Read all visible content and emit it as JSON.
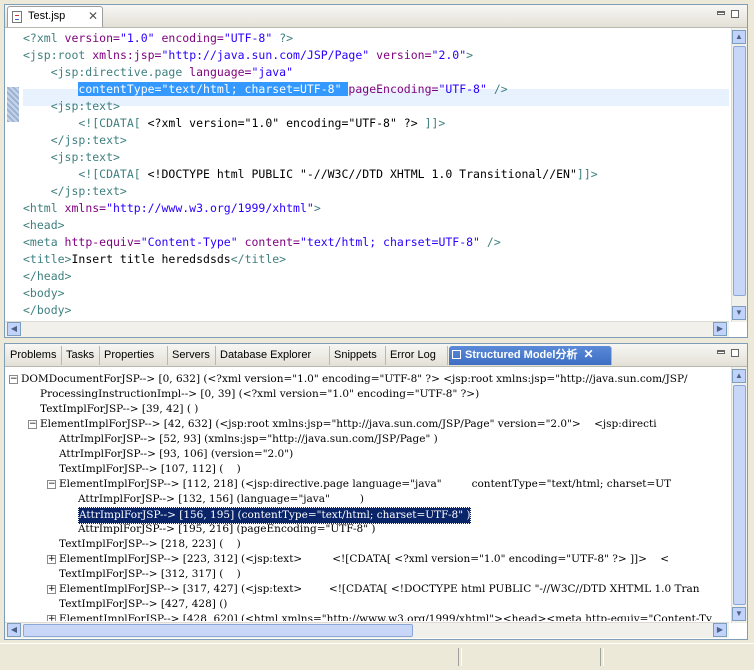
{
  "editor": {
    "tab_label": "Test.jsp",
    "lines": [
      [
        {
          "t": "<?xml ",
          "c": "kw"
        },
        {
          "t": "version=",
          "c": "an"
        },
        {
          "t": "\"1.0\"",
          "c": "av"
        },
        {
          "t": " encoding=",
          "c": "an"
        },
        {
          "t": "\"UTF-8\"",
          "c": "av"
        },
        {
          "t": " ?>",
          "c": "kw"
        }
      ],
      [
        {
          "t": "<jsp:root ",
          "c": "kw"
        },
        {
          "t": "xmlns:jsp=",
          "c": "an"
        },
        {
          "t": "\"http://java.sun.com/JSP/Page\"",
          "c": "av"
        },
        {
          "t": " version=",
          "c": "an"
        },
        {
          "t": "\"2.0\"",
          "c": "av"
        },
        {
          "t": ">",
          "c": "kw"
        }
      ],
      [
        {
          "t": "    <jsp:directive.page ",
          "c": "kw"
        },
        {
          "t": "language=",
          "c": "an"
        },
        {
          "t": "\"java\"",
          "c": "av"
        }
      ],
      [
        {
          "t": "        ",
          "c": "tx"
        },
        {
          "t": "contentType=\"text/html; charset=UTF-8\" ",
          "c": "sel"
        },
        {
          "t": "pageEncoding=",
          "c": "an"
        },
        {
          "t": "\"UTF-8\"",
          "c": "av"
        },
        {
          "t": " />",
          "c": "kw"
        }
      ],
      [
        {
          "t": "    <jsp:text>",
          "c": "kw"
        }
      ],
      [
        {
          "t": "        <![CDATA[ ",
          "c": "kw"
        },
        {
          "t": "<?xml version=\"1.0\" encoding=\"UTF-8\" ?> ",
          "c": "tx"
        },
        {
          "t": "]]>",
          "c": "kw"
        }
      ],
      [
        {
          "t": "    </jsp:text>",
          "c": "kw"
        }
      ],
      [
        {
          "t": "    <jsp:text>",
          "c": "kw"
        }
      ],
      [
        {
          "t": "        <![CDATA[ ",
          "c": "kw"
        },
        {
          "t": "<!DOCTYPE html PUBLIC \"-//W3C//DTD XHTML 1.0 Transitional//EN\"",
          "c": "tx"
        },
        {
          "t": "]]>",
          "c": "kw"
        }
      ],
      [
        {
          "t": "    </jsp:text>",
          "c": "kw"
        }
      ],
      [
        {
          "t": "<html ",
          "c": "kw"
        },
        {
          "t": "xmlns=",
          "c": "an"
        },
        {
          "t": "\"http://www.w3.org/1999/xhtml\"",
          "c": "av"
        },
        {
          "t": ">",
          "c": "kw"
        }
      ],
      [
        {
          "t": "<head>",
          "c": "kw"
        }
      ],
      [
        {
          "t": "<meta ",
          "c": "kw"
        },
        {
          "t": "http-equiv=",
          "c": "an"
        },
        {
          "t": "\"Content-Type\"",
          "c": "av"
        },
        {
          "t": " content=",
          "c": "an"
        },
        {
          "t": "\"text/html; charset=UTF-8\"",
          "c": "av"
        },
        {
          "t": " />",
          "c": "kw"
        }
      ],
      [
        {
          "t": "<title>",
          "c": "kw"
        },
        {
          "t": "Insert title heredsdsds",
          "c": "tx"
        },
        {
          "t": "</title>",
          "c": "kw"
        }
      ],
      [
        {
          "t": "</head>",
          "c": "kw"
        }
      ],
      [
        {
          "t": "<body>",
          "c": "kw"
        }
      ],
      [
        {
          "t": "</body>",
          "c": "kw"
        }
      ]
    ]
  },
  "views": {
    "tabs": [
      "Problems",
      "Tasks",
      "Properties",
      "Servers",
      "Database Explorer",
      "Snippets",
      "Error Log",
      "Structured Model分析"
    ],
    "active_tab": "Structured Model分析"
  },
  "tree": [
    {
      "level": 0,
      "twisty": "-",
      "text": "DOMDocumentForJSP--> [0, 632] (<?xml version=\"1.0\" encoding=\"UTF-8\" ?> <jsp:root xmlns:jsp=\"http://java.sun.com/JSP/"
    },
    {
      "level": 1,
      "twisty": "",
      "text": "ProcessingInstructionImpl--> [0, 39] (<?xml version=\"1.0\" encoding=\"UTF-8\" ?>)"
    },
    {
      "level": 1,
      "twisty": "",
      "text": "TextImplForJSP--> [39, 42] ( )"
    },
    {
      "level": 1,
      "twisty": "-",
      "text": "ElementImplForJSP--> [42, 632] (<jsp:root xmlns:jsp=\"http://java.sun.com/JSP/Page\" version=\"2.0\">    <jsp:directi"
    },
    {
      "level": 2,
      "twisty": "",
      "text": "AttrImplForJSP--> [52, 93] (xmlns:jsp=\"http://java.sun.com/JSP/Page\" )"
    },
    {
      "level": 2,
      "twisty": "",
      "text": "AttrImplForJSP--> [93, 106] (version=\"2.0\")"
    },
    {
      "level": 2,
      "twisty": "",
      "text": "TextImplForJSP--> [107, 112] (    )"
    },
    {
      "level": 2,
      "twisty": "-",
      "text": "ElementImplForJSP--> [112, 218] (<jsp:directive.page language=\"java\"         contentType=\"text/html; charset=UT"
    },
    {
      "level": 3,
      "twisty": "",
      "text": "AttrImplForJSP--> [132, 156] (language=\"java\"         )"
    },
    {
      "level": 3,
      "twisty": "",
      "text": "AttrImplForJSP--> [156, 195] (contentType=\"text/html; charset=UTF-8\" )",
      "selected": true
    },
    {
      "level": 3,
      "twisty": "",
      "text": "AttrImplForJSP--> [195, 216] (pageEncoding=\"UTF-8\" )"
    },
    {
      "level": 2,
      "twisty": "",
      "text": "TextImplForJSP--> [218, 223] (    )"
    },
    {
      "level": 2,
      "twisty": "+",
      "text": "ElementImplForJSP--> [223, 312] (<jsp:text>         <![CDATA[ <?xml version=\"1.0\" encoding=\"UTF-8\" ?> ]]>    <"
    },
    {
      "level": 2,
      "twisty": "",
      "text": "TextImplForJSP--> [312, 317] (    )"
    },
    {
      "level": 2,
      "twisty": "+",
      "text": "ElementImplForJSP--> [317, 427] (<jsp:text>        <![CDATA[ <!DOCTYPE html PUBLIC \"-//W3C//DTD XHTML 1.0 Tran"
    },
    {
      "level": 2,
      "twisty": "",
      "text": "TextImplForJSP--> [427, 428] ()"
    },
    {
      "level": 2,
      "twisty": "+",
      "text": "ElementImplForJSP--> [428, 620] (<html xmlns=\"http://www.w3.org/1999/xhtml\"><head><meta http-equiv=\"Content-Ty"
    }
  ]
}
